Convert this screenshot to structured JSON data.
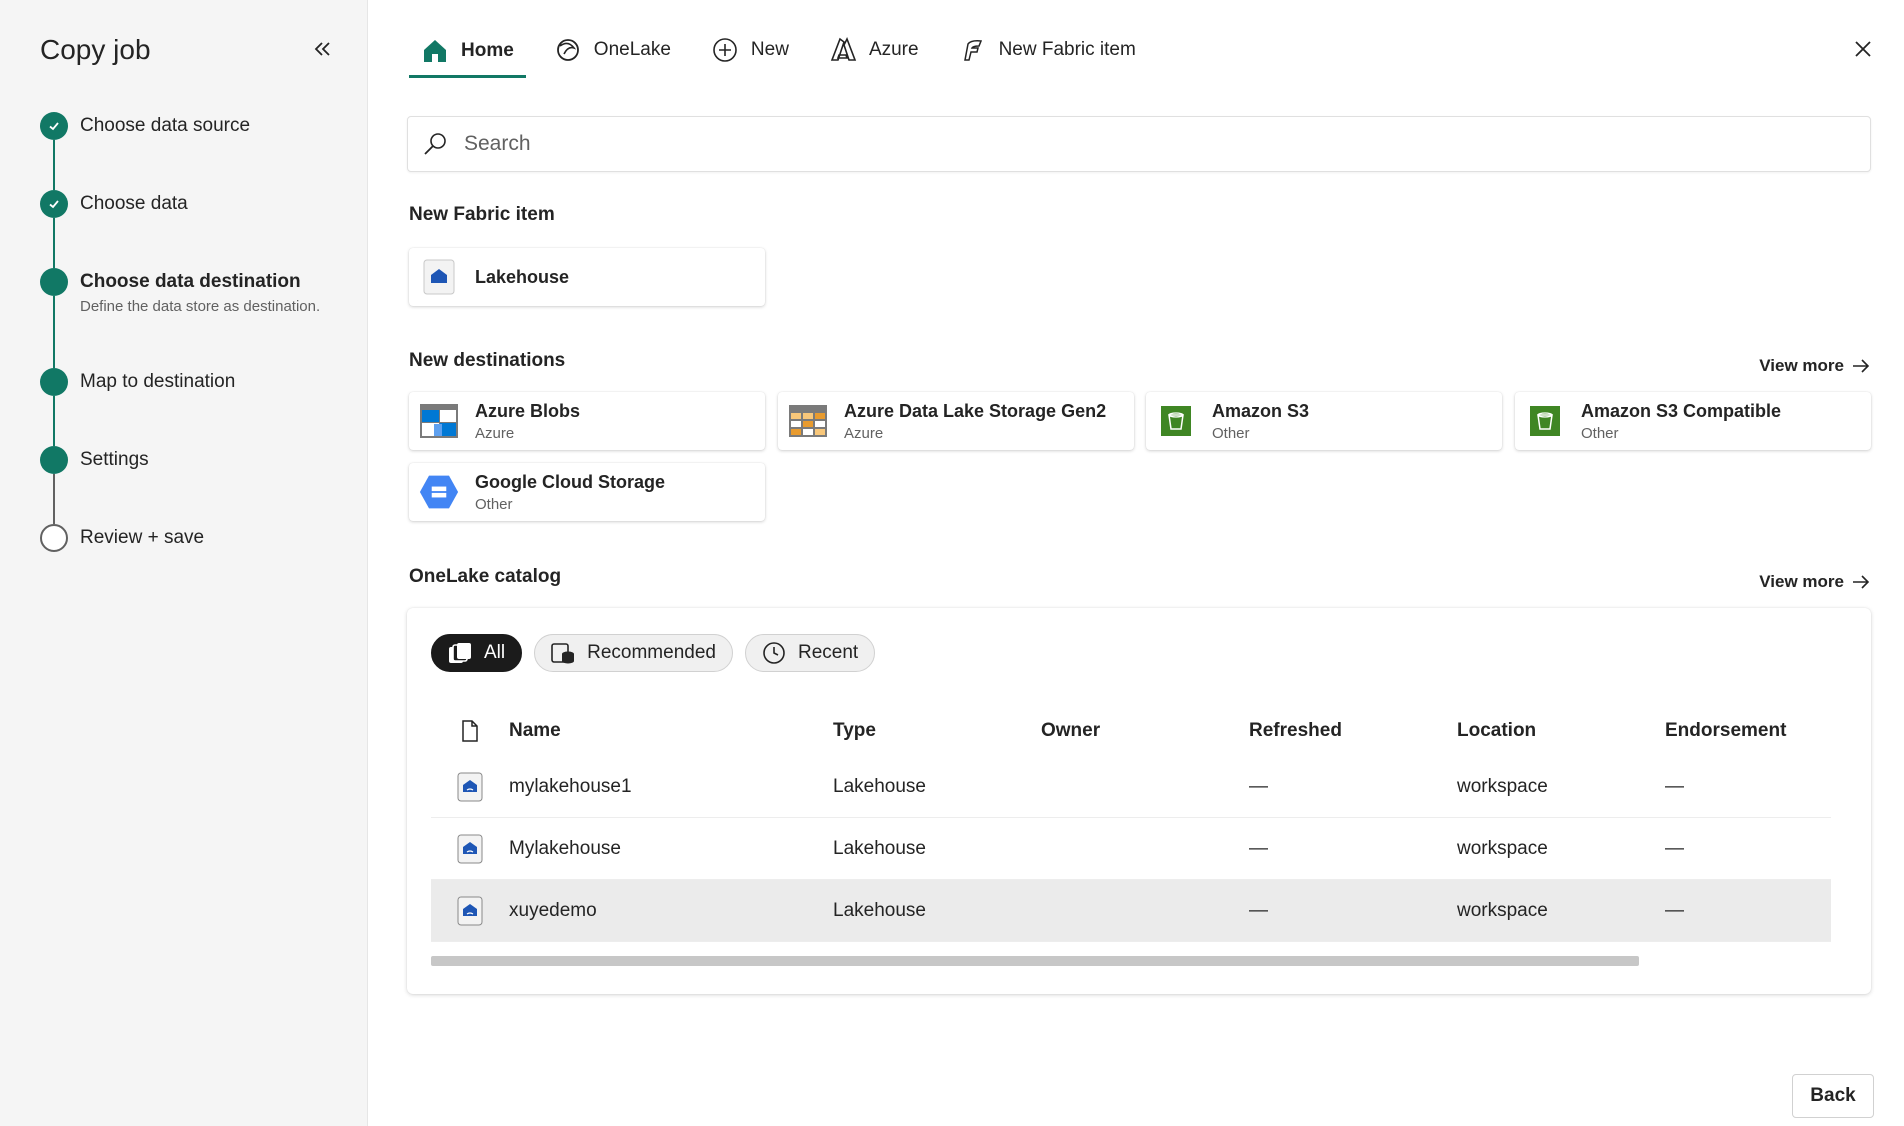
{
  "sidebar": {
    "title": "Copy job",
    "steps": [
      {
        "label": "Choose data source",
        "state": "done"
      },
      {
        "label": "Choose data",
        "state": "done"
      },
      {
        "label": "Choose data destination",
        "sub": "Define the data store as destination.",
        "state": "current"
      },
      {
        "label": "Map to destination",
        "state": "todo"
      },
      {
        "label": "Settings",
        "state": "todo"
      },
      {
        "label": "Review + save",
        "state": "pending"
      }
    ]
  },
  "tabs": [
    {
      "label": "Home",
      "icon": "home-icon",
      "active": true
    },
    {
      "label": "OneLake",
      "icon": "onelake-icon"
    },
    {
      "label": "New",
      "icon": "add-circle-icon"
    },
    {
      "label": "Azure",
      "icon": "azure-icon"
    },
    {
      "label": "New Fabric item",
      "icon": "fabric-icon"
    }
  ],
  "search": {
    "placeholder": "Search"
  },
  "new_fabric_item": {
    "title": "New Fabric item",
    "cards": [
      {
        "name": "Lakehouse",
        "icon": "lakehouse-icon"
      }
    ]
  },
  "new_destinations": {
    "title": "New destinations",
    "view_more": "View more",
    "cards": [
      {
        "name": "Azure Blobs",
        "sub": "Azure",
        "icon": "azure-blobs-icon"
      },
      {
        "name": "Azure Data Lake Storage Gen2",
        "sub": "Azure",
        "icon": "adls-gen2-icon"
      },
      {
        "name": "Amazon S3",
        "sub": "Other",
        "icon": "amazon-s3-icon"
      },
      {
        "name": "Amazon S3 Compatible",
        "sub": "Other",
        "icon": "amazon-s3-compatible-icon"
      },
      {
        "name": "Google Cloud Storage",
        "sub": "Other",
        "icon": "google-cloud-storage-icon"
      }
    ]
  },
  "catalog": {
    "title": "OneLake catalog",
    "view_more": "View more",
    "filters": [
      {
        "label": "All",
        "active": true
      },
      {
        "label": "Recommended"
      },
      {
        "label": "Recent"
      }
    ],
    "columns": [
      "Name",
      "Type",
      "Owner",
      "Refreshed",
      "Location",
      "Endorsement"
    ],
    "rows": [
      {
        "name": "mylakehouse1",
        "type": "Lakehouse",
        "owner": "",
        "refreshed": "—",
        "location": "workspace",
        "endorsement": "—"
      },
      {
        "name": "Mylakehouse",
        "type": "Lakehouse",
        "owner": "",
        "refreshed": "—",
        "location": "workspace",
        "endorsement": "—"
      },
      {
        "name": "xuyedemo",
        "type": "Lakehouse",
        "owner": "",
        "refreshed": "—",
        "location": "workspace",
        "endorsement": "—",
        "selected": true
      }
    ]
  },
  "footer": {
    "back_label": "Back"
  },
  "colors": {
    "accent": "#117865",
    "pill_active": "#1b1b1b",
    "selected_row": "#ebebeb"
  }
}
